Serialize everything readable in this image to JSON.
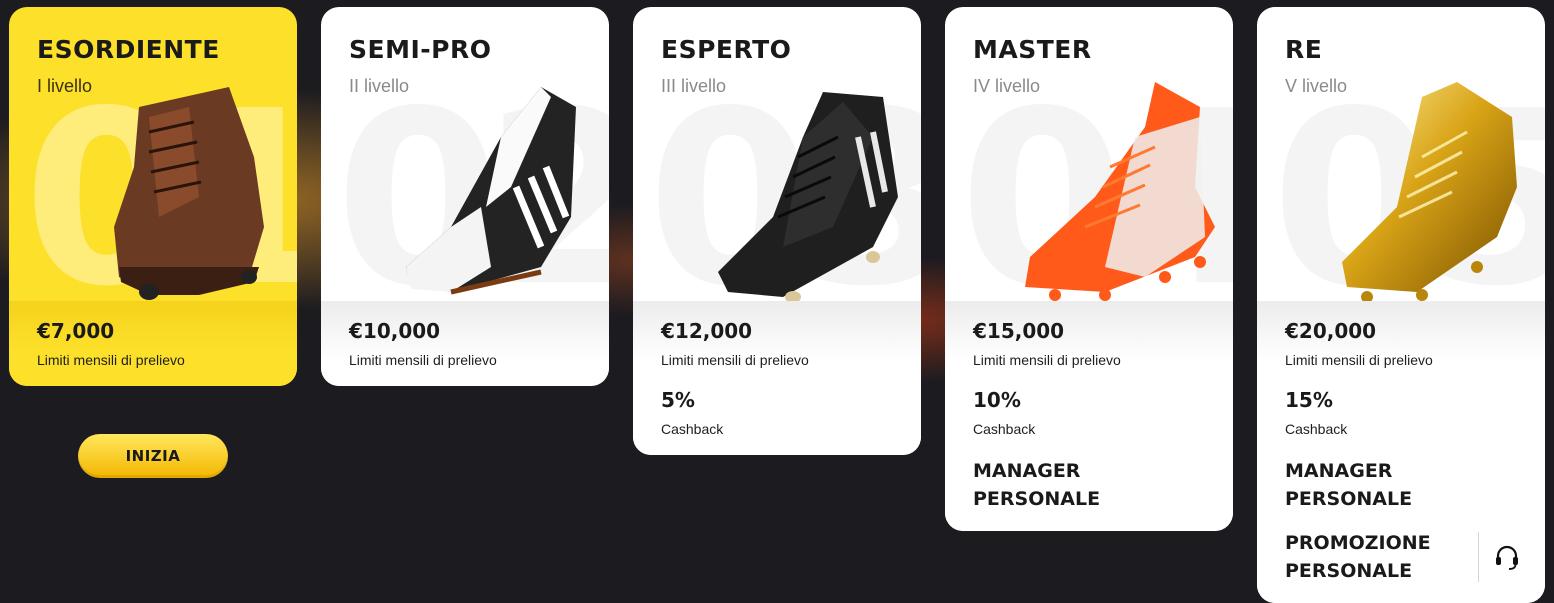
{
  "tiers": [
    {
      "title": "ESORDIENTE",
      "level": "I livello",
      "number": "01",
      "amount": "€7,000",
      "limit_label": "Limiti mensili di prelievo"
    },
    {
      "title": "SEMI-PRO",
      "level": "II livello",
      "number": "02",
      "amount": "€10,000",
      "limit_label": "Limiti mensili di prelievo"
    },
    {
      "title": "ESPERTO",
      "level": "III livello",
      "number": "03",
      "amount": "€12,000",
      "limit_label": "Limiti mensili di prelievo",
      "cashback": "5%",
      "cashback_label": "Cashback"
    },
    {
      "title": "MASTER",
      "level": "IV livello",
      "number": "04",
      "amount": "€15,000",
      "limit_label": "Limiti mensili di prelievo",
      "cashback": "10%",
      "cashback_label": "Cashback",
      "manager": "MANAGER PERSONALE"
    },
    {
      "title": "RE",
      "level": "V livello",
      "number": "05",
      "amount": "€20,000",
      "limit_label": "Limiti mensili di prelievo",
      "cashback": "15%",
      "cashback_label": "Cashback",
      "manager": "MANAGER PERSONALE",
      "promo": "PROMOZIONE\nPERSONALE"
    }
  ],
  "start_button": "INIZIA",
  "colors": {
    "active_card": "#fde02a",
    "background": "#1c1b20",
    "button": "#f3b600"
  },
  "icons": {
    "support": "headset-icon"
  }
}
